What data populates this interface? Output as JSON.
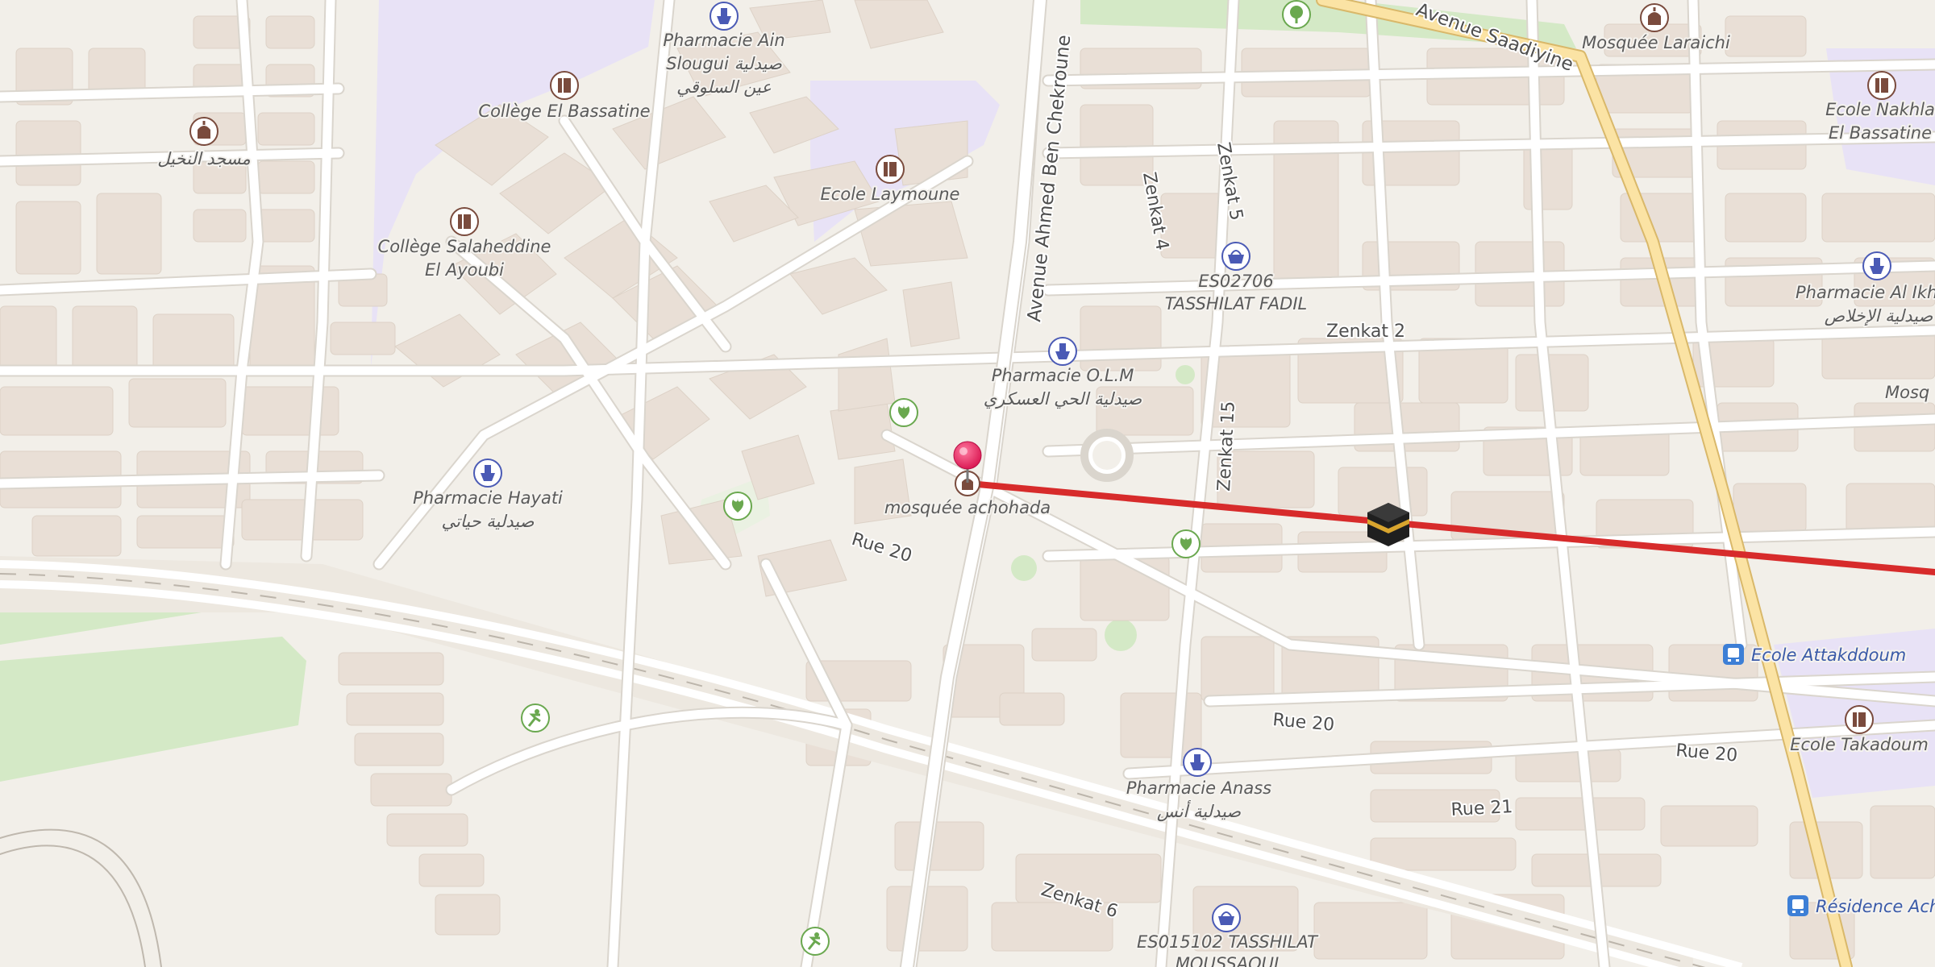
{
  "map": {
    "colors": {
      "land": "#f2efe9",
      "block": "#e9dfd6",
      "road": "#ffffff",
      "road_casing": "#dad5cd",
      "school_area": "#e8e2f6",
      "park": "#d4e9c6",
      "main_road": "#fbe3a4",
      "route": "#d72b2b",
      "pin": "#e8205f",
      "icon_brown": "#7a4b3d",
      "icon_blue": "#4a5ab5",
      "icon_green": "#6aa84f"
    },
    "streets": {
      "avenue_saadiyine": "Avenue Saadiyine",
      "avenue_chekroune": "Avenue Ahmed Ben Chekroune",
      "zenkat_4": "Zenkat 4",
      "zenkat_5": "Zenkat 5",
      "zenkat_2": "Zenkat 2",
      "zenkat_15": "Zenkat 15",
      "rue_20_a": "Rue 20",
      "rue_20_b": "Rue 20",
      "rue_20_c": "Rue 20",
      "rue_21": "Rue 21",
      "zenkat_6": "Zenkat 6"
    },
    "pois": {
      "pharmacie_ain_l1": "Pharmacie Ain",
      "pharmacie_ain_l2": "Slougui صيدلية",
      "pharmacie_ain_l3": "عين السلوقي",
      "mosquee_laraichi": "Mosquée Laraichi",
      "ecole_nakhla_l1": "Ecole Nakhla",
      "ecole_nakhla_l2": "El Bassatine",
      "masjid_nakhil": "مسجد النخيل",
      "college_bassatine": "Collège El Bassatine",
      "ecole_laymoune": "Ecole Laymoune",
      "college_salaheddine_l1": "Collège Salaheddine",
      "college_salaheddine_l2": "El Ayoubi",
      "shop_es02706_l1": "ES02706",
      "shop_es02706_l2": "TASSHILAT FADIL",
      "pharmacie_ikhlas_l1": "Pharmacie Al Ikhlas",
      "pharmacie_ikhlas_l2": "صيدلية الإخلاص",
      "mosq_partial": "Mosq",
      "pharmacie_olm_l1": "Pharmacie O.L.M",
      "pharmacie_olm_l2": "صيدلية الحي العسكري",
      "pharmacie_hayati_l1": "Pharmacie Hayati",
      "pharmacie_hayati_l2": "صيدلية حياتي",
      "mosquee_achohada": "mosquée achohada",
      "bus_attakddoum": "Ecole Attakddoum",
      "ecole_takadoum": "Ecole Takadoum",
      "pharmacie_anass_l1": "Pharmacie Anass",
      "pharmacie_anass_l2": "صيدلية أنس",
      "shop_es015102_l1": "ES015102 TASSHILAT",
      "shop_es015102_l2": "MOUSSAOUI",
      "bus_residence": "Résidence Achohada"
    }
  }
}
